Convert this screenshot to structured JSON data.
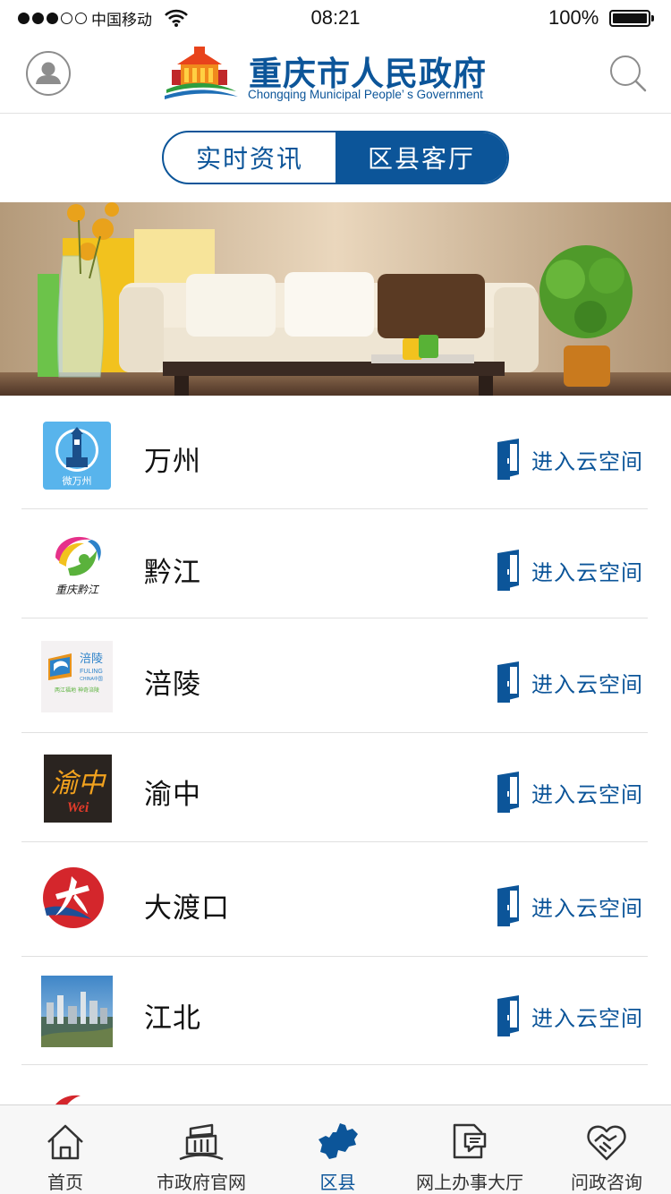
{
  "status_bar": {
    "carrier": "中国移动",
    "time": "08:21",
    "battery": "100%"
  },
  "header": {
    "title": "重庆市人民政府",
    "subtitle": "Chongqing Municipal People’ s Government",
    "avatar_icon": "user-icon",
    "search_icon": "search-icon"
  },
  "segment": {
    "tabs": [
      {
        "label": "实时资讯",
        "active": false
      },
      {
        "label": "区县客厅",
        "active": true
      }
    ]
  },
  "districts": [
    {
      "name": "万州",
      "action": "进入云空间",
      "logo_text": "微万州"
    },
    {
      "name": "黔江",
      "action": "进入云空间",
      "logo_text": "重庆黔江"
    },
    {
      "name": "涪陵",
      "action": "进入云空间",
      "logo_text": "涪陵",
      "logo_sub1": "FULING",
      "logo_sub2": "CHINA中国",
      "logo_sub3": "两江福地  神奇涪陵"
    },
    {
      "name": "渝中",
      "action": "进入云空间",
      "logo_text": "渝中",
      "logo_sub1": "Wei"
    },
    {
      "name": "大渡口",
      "action": "进入云空间"
    },
    {
      "name": "江北",
      "action": "进入云空间"
    }
  ],
  "tab_bar": {
    "items": [
      {
        "label": "首页",
        "icon": "home-icon"
      },
      {
        "label": "市政府官网",
        "icon": "government-building-icon"
      },
      {
        "label": "区县",
        "icon": "chongqing-map-icon",
        "active": true
      },
      {
        "label": "网上办事大厅",
        "icon": "document-chat-icon"
      },
      {
        "label": "问政咨询",
        "icon": "handshake-heart-icon"
      }
    ]
  },
  "colors": {
    "brand": "#0c5599",
    "divider": "#e0e0e0"
  }
}
